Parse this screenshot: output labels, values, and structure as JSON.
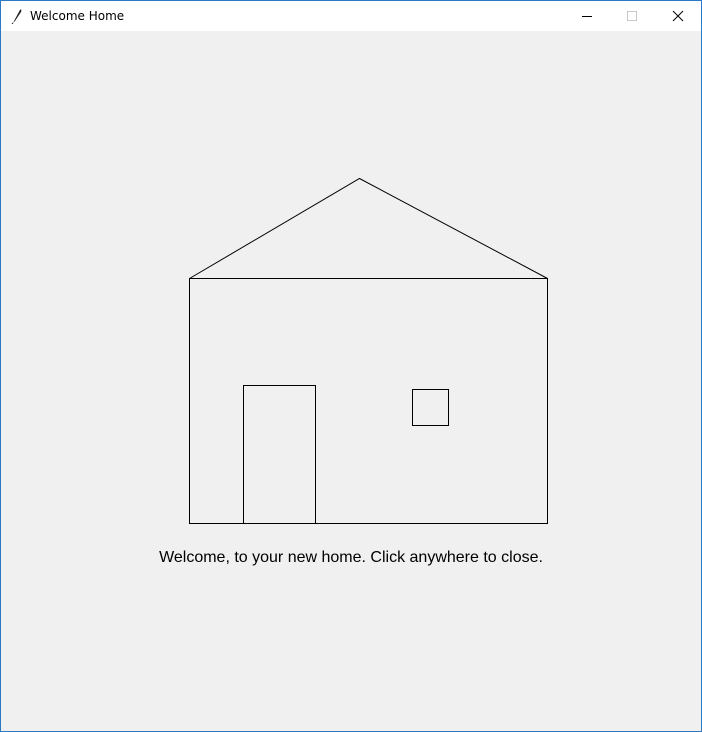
{
  "window": {
    "title": "Welcome Home",
    "icon": "feather-icon",
    "controls": [
      "minimize-icon",
      "maximize-icon",
      "close-icon"
    ]
  },
  "canvas": {
    "message": "Welcome, to your new home. Click anywhere to close.",
    "drawing": [
      "roof",
      "house-body",
      "door",
      "window"
    ]
  },
  "colors": {
    "background": "#f0f0f0",
    "titlebar": "#ffffff",
    "border": "#2b79c2",
    "stroke": "#000000"
  }
}
